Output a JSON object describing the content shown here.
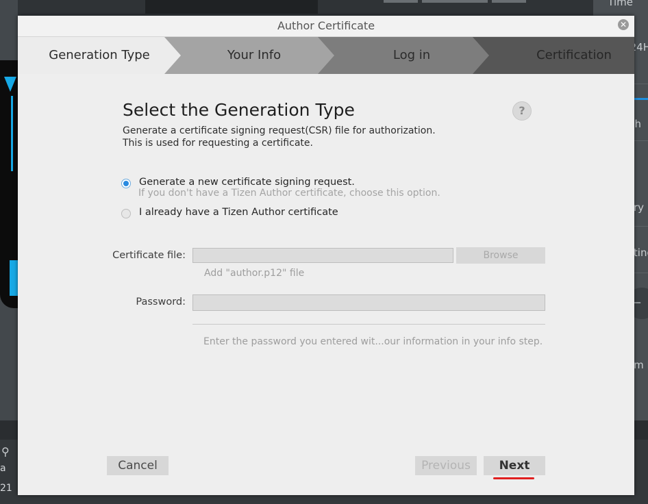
{
  "background": {
    "right_panel_items": [
      "Time",
      "24H",
      "h",
      "ry",
      "ting",
      "m D"
    ],
    "left_items": [
      "a",
      "21"
    ]
  },
  "dialog": {
    "title": "Author Certificate",
    "close_icon": "close-icon",
    "steps": [
      {
        "label": "Generation Type",
        "active": true
      },
      {
        "label": "Your Info",
        "active": false
      },
      {
        "label": "Log in",
        "active": false
      },
      {
        "label": "Certification",
        "active": false
      }
    ],
    "heading": "Select the Generation Type",
    "description_line1": "Generate a certificate signing request(CSR) file for authorization.",
    "description_line2": "This is used for requesting a certificate.",
    "help_icon_label": "?",
    "options": [
      {
        "label": "Generate a new certificate signing request.",
        "sublabel": "If you don't have a Tizen Author certificate, choose this option.",
        "checked": true
      },
      {
        "label": "I already have a Tizen Author certificate",
        "checked": false
      }
    ],
    "certificate_file": {
      "label": "Certificate file:",
      "value": "",
      "browse_label": "Browse",
      "hint": "Add \"author.p12\" file"
    },
    "password": {
      "label": "Password:",
      "value": "",
      "hint": "Enter the password you entered wit...our information in your info step."
    },
    "buttons": {
      "cancel": "Cancel",
      "previous": "Previous",
      "next": "Next"
    }
  },
  "colors": {
    "accent_radio": "#2a8ae0",
    "next_highlight": "#e02020"
  }
}
